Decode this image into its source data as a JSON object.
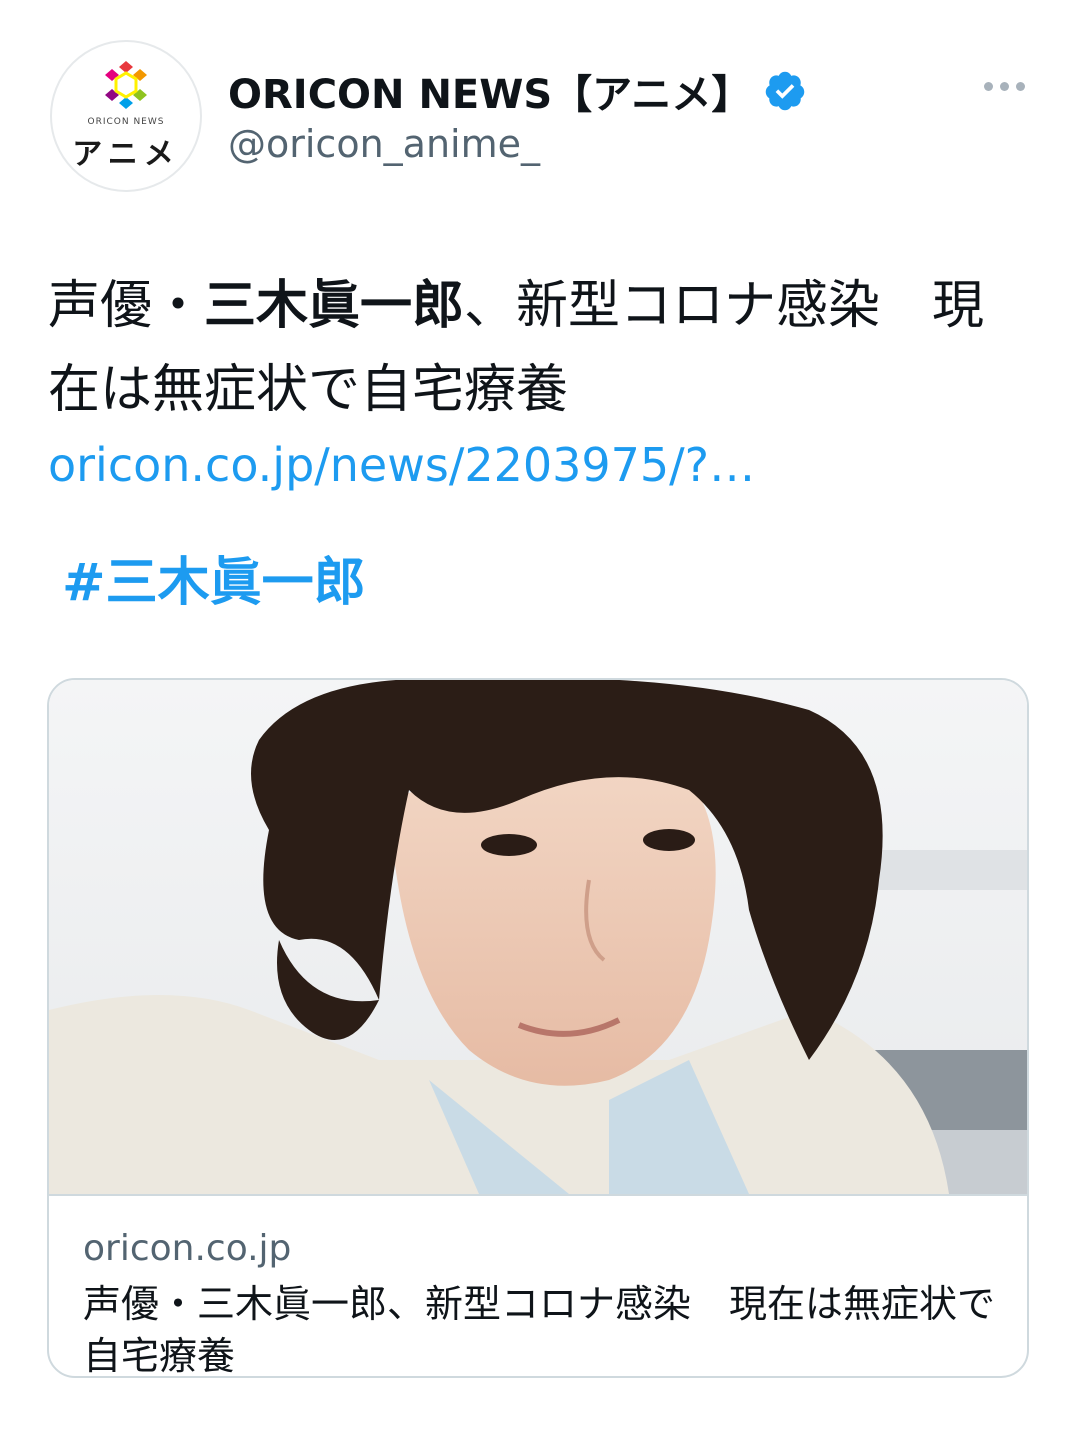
{
  "account": {
    "display_name": "ORICON NEWS【アニメ】",
    "handle": "@oricon_anime_",
    "avatar_small_text": "ORICON NEWS",
    "avatar_big_text": "アニメ",
    "verified": true
  },
  "tweet": {
    "text_prefix": "声優・",
    "text_bold": "三木眞一郎",
    "text_suffix": "、新型コロナ感染　現在は無症状で自宅療養",
    "link": "oricon.co.jp/news/2203975/?…",
    "hashtag": "#三木眞一郎"
  },
  "card": {
    "domain": "oricon.co.jp",
    "title": "声優・三木眞一郎、新型コロナ感染　現在は無症状で自宅療養"
  },
  "colors": {
    "link": "#1d9bf0",
    "text": "#0f1419",
    "secondary": "#536471",
    "border": "#cfd9de"
  },
  "icons": {
    "verified": "verified-badge-icon",
    "more": "more-options-icon",
    "logo": "oricon-hexagon-logo"
  }
}
